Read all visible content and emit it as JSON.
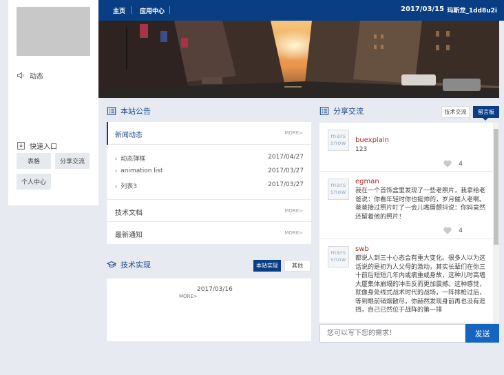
{
  "sidebar": {
    "dynamic_label": "动态",
    "quick_label": "快速入口",
    "quick_buttons": [
      "表格",
      "分享交流",
      "个人中心"
    ]
  },
  "topbar": {
    "nav": [
      "主页",
      "应用中心"
    ],
    "date": "2017/03/15",
    "user": "玛斯龙_1dd8u2i"
  },
  "notice": {
    "title": "本站公告",
    "sections": [
      {
        "label": "新闻动态",
        "more": "MORE>"
      },
      {
        "label": "技术文档",
        "more": "MORE>"
      },
      {
        "label": "最新通知",
        "more": "MORE>"
      }
    ],
    "items": [
      {
        "title": "动态弹框",
        "date": "2017/04/27"
      },
      {
        "title": "animation list",
        "date": "2017/03/27"
      },
      {
        "title": "列表3",
        "date": "2017/03/27"
      }
    ]
  },
  "tech": {
    "title": "技术实现",
    "tabs": [
      "本站实现",
      "其他"
    ],
    "date": "2017/03/16",
    "more": "MORE>"
  },
  "share": {
    "title": "分享交流",
    "tabs": [
      "技术交流",
      "留言板"
    ],
    "avatar_text": [
      "mars",
      "snow"
    ],
    "messages": [
      {
        "name": "buexplain",
        "text": "123",
        "likes": "4"
      },
      {
        "name": "egman",
        "text": "我在一个首饰盒里发现了一些老照片，我拿给老爸说：你看年轻时你也挺帅的，岁月催人老啊。爸爸接过照片盯了一会儿嘴唇颤抖说：你妈竟然还留着他的照片！",
        "likes": "4"
      },
      {
        "name": "swb",
        "text": "都说人到三十心态会有重大变化。很多人以为这话说的是初为人父母的激动，其实长辈们在你三十前后短短几年内或病重或身故，这种儿时高墙大厦集体崩塌的冲击反而更加震撼。这种感觉，就像身处线式战术时代的战场，一阵排枪过后，等到眼前硝烟散尽，你赫然发现身前再也没有遮挡，自己已然位于战阵的第一排",
        "likes": ""
      }
    ],
    "input_placeholder": "您可以写下您的需求！",
    "send_label": "发送"
  },
  "colors": {
    "brand": "#0a3e84",
    "send": "#1565c0",
    "username": "#a0282a"
  }
}
